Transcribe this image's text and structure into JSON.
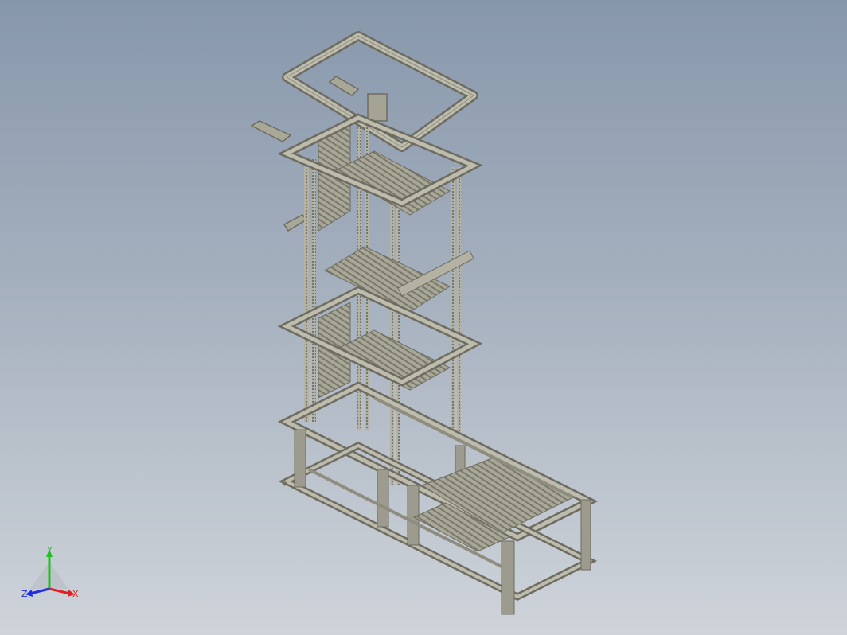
{
  "viewport": {
    "background_top": "#8797ab",
    "background_bottom": "#cfd4da"
  },
  "model": {
    "description_icon": "3d-assembly-frame-icon",
    "frame_color": "#9d9b8d",
    "frame_dark": "#6e6c60",
    "frame_light": "#c9c7b8"
  },
  "triad": {
    "x_label": "X",
    "y_label": "Y",
    "z_label": "Z",
    "x_color": "#e02020",
    "y_color": "#20c020",
    "z_color": "#2030e0"
  }
}
